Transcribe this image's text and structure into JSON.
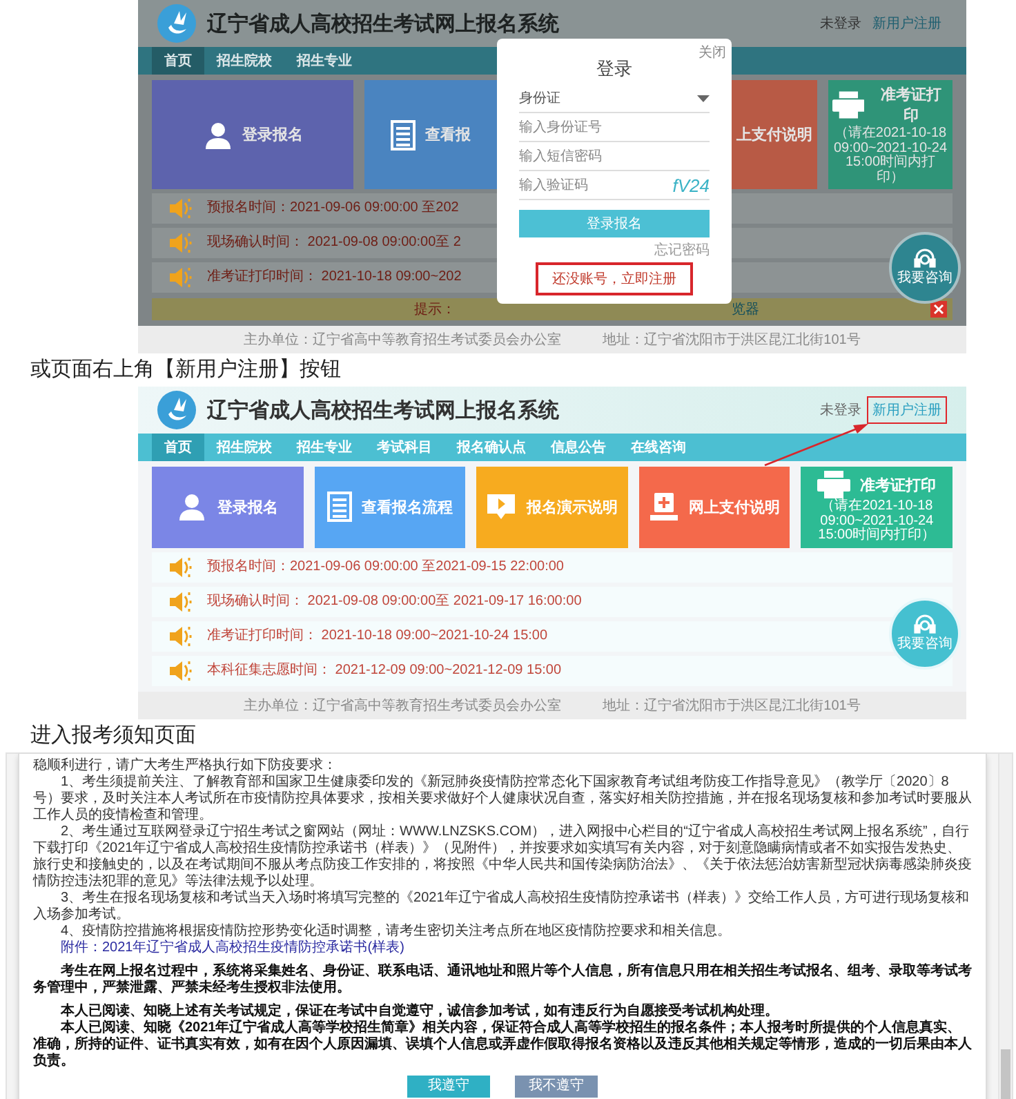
{
  "steps": [
    {
      "kind": "portal",
      "site_title": "辽宁省成人高校招生考试网上报名系统",
      "login_status": "未登录",
      "register_link": {
        "text": "新用户注册",
        "highlighted": false
      },
      "nav": [
        {
          "label": "首页",
          "selected": true
        },
        {
          "label": "招生院校",
          "selected": false
        },
        {
          "label": "招生专业",
          "selected": false
        }
      ],
      "tiles_left": [
        {
          "label": "登录报名",
          "kind": "person",
          "color": "#5d63ad"
        },
        {
          "label": "查看报",
          "kind": "document",
          "color": "#4a84c0"
        }
      ],
      "tiles_right": [
        {
          "label": "上支付说明",
          "color": "#b85a45"
        },
        {
          "label": "准考证打印",
          "kind": "printer",
          "color": "#2f9478",
          "subtitle": "（请在2021-10-18 09:00~2021-10-24 15:00时间内打印）"
        }
      ],
      "notices": [
        {
          "text": "预报名时间：2021-09-06 09:00:00 至202"
        },
        {
          "text": "现场确认时间： 2021-09-08 09:00:00至 2"
        },
        {
          "text": "准考证打印时间： 2021-10-18 09:00~202"
        }
      ],
      "tip_bar": {
        "label": "提示：",
        "tail": "览器"
      },
      "chat_button": "我要咨询",
      "footer": {
        "organizer": "主办单位：辽宁省高中等教育招生考试委员会办公室",
        "address": "地址：辽宁省沈阳市于洪区昆江北街101号"
      },
      "login_dialog": {
        "close": "关闭",
        "title": "登录",
        "id_type": "身份证",
        "fields": [
          {
            "placeholder": "输入身份证号"
          },
          {
            "placeholder": "输入短信密码"
          },
          {
            "placeholder": "输入验证码",
            "captcha": "fV24"
          }
        ],
        "submit": "登录报名",
        "forgot": "忘记密码",
        "register": {
          "text": "还没账号，立即注册",
          "highlighted": true
        }
      }
    },
    {
      "kind": "caption",
      "text": "或页面右上角【新用户注册】按钮"
    },
    {
      "kind": "portal",
      "site_title": "辽宁省成人高校招生考试网上报名系统",
      "login_status": "未登录",
      "register_link": {
        "text": "新用户注册",
        "highlighted": true
      },
      "arrow_to_register": true,
      "nav": [
        {
          "label": "首页",
          "selected": true
        },
        {
          "label": "招生院校",
          "selected": false
        },
        {
          "label": "招生专业",
          "selected": false
        },
        {
          "label": "考试科目",
          "selected": false
        },
        {
          "label": "报名确认点",
          "selected": false
        },
        {
          "label": "信息公告",
          "selected": false
        },
        {
          "label": "在线咨询",
          "selected": false
        }
      ],
      "tiles": [
        {
          "label": "登录报名",
          "kind": "person",
          "color": "#7b86e6"
        },
        {
          "label": "查看报名流程",
          "kind": "document",
          "color": "#57a6f3"
        },
        {
          "label": "报名演示说明",
          "kind": "video",
          "color": "#f7ab1f"
        },
        {
          "label": "网上支付说明",
          "kind": "payment",
          "color": "#f4694b"
        },
        {
          "label": "准考证打印",
          "kind": "printer",
          "color": "#2dbb94",
          "subtitle": "（请在2021-10-18 09:00~2021-10-24 15:00时间内打印）"
        }
      ],
      "notices": [
        {
          "text": "预报名时间：2021-09-06 09:00:00 至2021-09-15 22:00:00"
        },
        {
          "text": "现场确认时间： 2021-09-08 09:00:00至 2021-09-17 16:00:00"
        },
        {
          "text": "准考证打印时间： 2021-10-18 09:00~2021-10-24 15:00"
        },
        {
          "text": "本科征集志愿时间： 2021-12-09 09:00~2021-12-09 15:00"
        }
      ],
      "chat_button": "我要咨询",
      "footer": {
        "organizer": "主办单位：辽宁省高中等教育招生考试委员会办公室",
        "address": "地址：辽宁省沈阳市于洪区昆江北街101号"
      }
    },
    {
      "kind": "caption",
      "text": "进入报考须知页面"
    },
    {
      "kind": "agreement",
      "sections": [
        {
          "paragraphs": [
            {
              "kind": "continuation",
              "text": "稳顺利进行，请广大考生严格执行如下防疫要求："
            },
            {
              "kind": "item",
              "text": "1、考生须提前关注、了解教育部和国家卫生健康委印发的《新冠肺炎疫情防控常态化下国家教育考试组考防疫工作指导意见》（教学厅〔2020〕8号）要求，及时关注本人考试所在市疫情防控具体要求，按相关要求做好个人健康状况自查，落实好相关防控措施，并在报名现场复核和参加考试时要服从工作人员的疫情检查和管理。"
            },
            {
              "kind": "item",
              "text": "2、考生通过互联网登录辽宁招生考试之窗网站（网址：WWW.LNZSKS.COM），进入网报中心栏目的“辽宁省成人高校招生考试网上报名系统”，自行下载打印《2021年辽宁省成人高校招生疫情防控承诺书（样表）》（见附件），并按要求如实填写有关内容，对于刻意隐瞒病情或者不如实报告发热史、旅行史和接触史的，以及在考试期间不服从考点防疫工作安排的，将按照《中华人民共和国传染病防治法》、《关于依法惩治妨害新型冠状病毒感染肺炎疫情防控违法犯罪的意见》等法律法规予以处理。"
            },
            {
              "kind": "item",
              "text": "3、考生在报名现场复核和考试当天入场时将填写完整的《2021年辽宁省成人高校招生疫情防控承诺书（样表）》交给工作人员，方可进行现场复核和入场参加考试。"
            },
            {
              "kind": "item",
              "text": "4、疫情防控措施将根据疫情防控形势变化适时调整，请考生密切关注考点所在地区疫情防控要求和相关信息。"
            },
            {
              "kind": "link",
              "text": "附件：2021年辽宁省成人高校招生疫情防控承诺书(样表)"
            }
          ]
        },
        {
          "paragraphs": [
            {
              "kind": "statement",
              "text": "考生在网上报名过程中，系统将采集姓名、身份证、联系电话、通讯地址和照片等个人信息，所有信息只用在相关招生考试报名、组考、录取等考试考务管理中，严禁泄露、严禁未经考生授权非法使用。"
            }
          ]
        },
        {
          "paragraphs": [
            {
              "kind": "statement",
              "text": "本人已阅读、知晓上述有关考试规定，保证在考试中自觉遵守，诚信参加考试，如有违反行为自愿接受考试机构处理。"
            },
            {
              "kind": "statement",
              "text": "本人已阅读、知晓《2021年辽宁省成人高等学校招生简章》相关内容，保证符合成人高等学校招生的报名条件；本人报考时所提供的个人信息真实、准确，所持的证件、证书真实有效，如有在因个人原因漏填、误填个人信息或弄虚作假取得报名资格以及违反其他相关规定等情形，造成的一切后果由本人负责。"
            }
          ]
        }
      ],
      "buttons": [
        {
          "label": "我遵守",
          "kind": "accept"
        },
        {
          "label": "我不遵守",
          "kind": "decline"
        }
      ]
    }
  ]
}
